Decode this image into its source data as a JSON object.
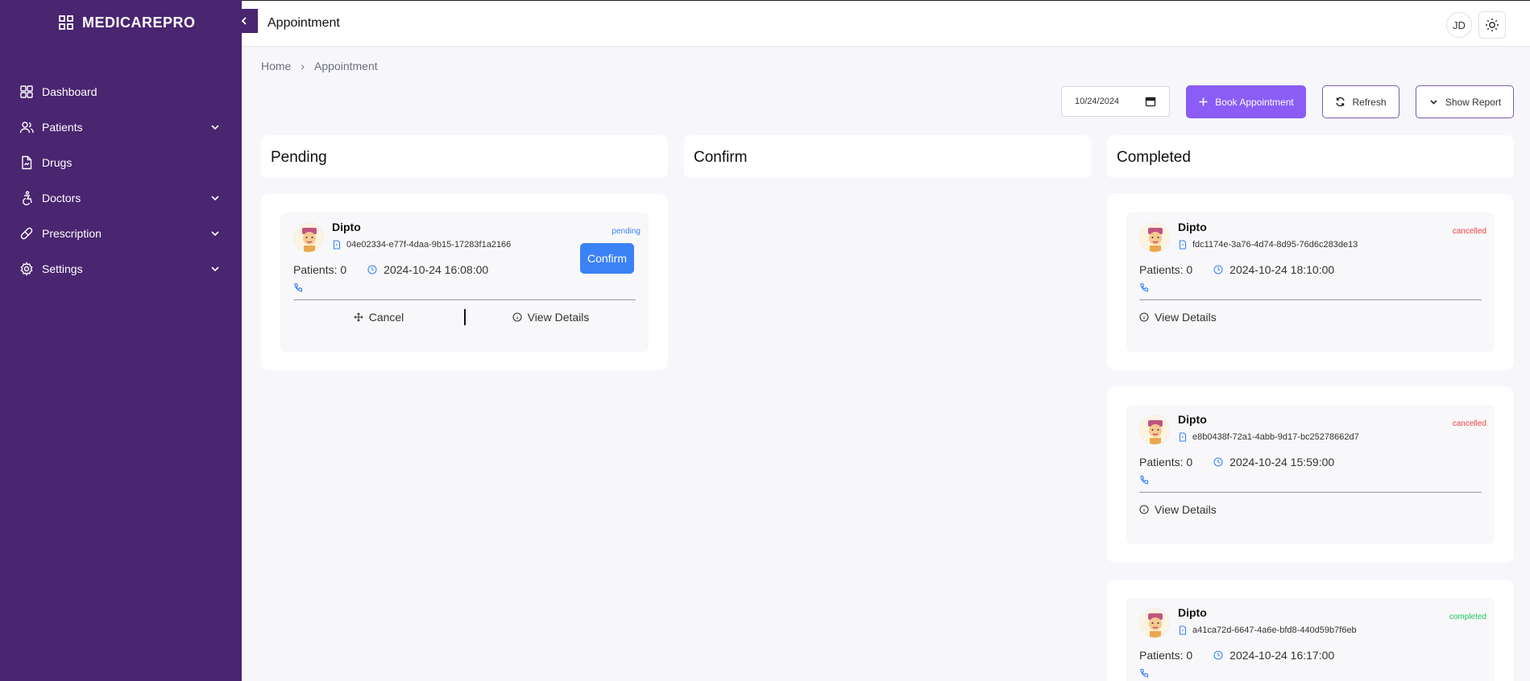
{
  "app": {
    "brand": "MEDICAREPRO"
  },
  "sidebar": {
    "items": [
      {
        "label": "Dashboard",
        "icon": "grid-icon",
        "expandable": false
      },
      {
        "label": "Patients",
        "icon": "users-icon",
        "expandable": true
      },
      {
        "label": "Drugs",
        "icon": "file-icon",
        "expandable": false
      },
      {
        "label": "Doctors",
        "icon": "accessibility-icon",
        "expandable": true
      },
      {
        "label": "Prescription",
        "icon": "pill-icon",
        "expandable": true
      },
      {
        "label": "Settings",
        "icon": "gear-icon",
        "expandable": true
      }
    ]
  },
  "header": {
    "title": "Appointment",
    "user_initials": "JD"
  },
  "breadcrumb": {
    "home": "Home",
    "separator": "›",
    "current": "Appointment"
  },
  "toolbar": {
    "date_value": "10/24/2024",
    "book_label": "Book Appointment",
    "refresh_label": "Refresh",
    "report_label": "Show Report"
  },
  "columns": {
    "pending": {
      "title": "Pending"
    },
    "confirm": {
      "title": "Confirm"
    },
    "completed": {
      "title": "Completed"
    }
  },
  "labels": {
    "confirm_button": "Confirm",
    "cancel": "Cancel",
    "view_details": "View Details",
    "patients_prefix": "Patients: "
  },
  "cards": {
    "pending": [
      {
        "name": "Dipto",
        "id": "04e02334-e77f-4daa-9b15-17283f1a2166",
        "status": "pending",
        "patients": "Patients: 0",
        "time": "2024-10-24 16:08:00"
      }
    ],
    "completed": [
      {
        "name": "Dipto",
        "id": "fdc1174e-3a76-4d74-8d95-76d6c283de13",
        "status": "cancelled",
        "patients": "Patients: 0",
        "time": "2024-10-24 18:10:00"
      },
      {
        "name": "Dipto",
        "id": "e8b0438f-72a1-4abb-9d17-bc25278662d7",
        "status": "cancelled",
        "patients": "Patients: 0",
        "time": "2024-10-24 15:59:00"
      },
      {
        "name": "Dipto",
        "id": "a41ca72d-6647-4a6e-bfd8-440d59b7f6eb",
        "status": "completed",
        "patients": "Patients: 0",
        "time": "2024-10-24 16:17:00"
      }
    ]
  },
  "colors": {
    "sidebar": "#4a2570",
    "accent": "#8b5cf6",
    "confirm": "#3b82f6",
    "cancelled": "#ef4444",
    "completed": "#22c55e"
  }
}
